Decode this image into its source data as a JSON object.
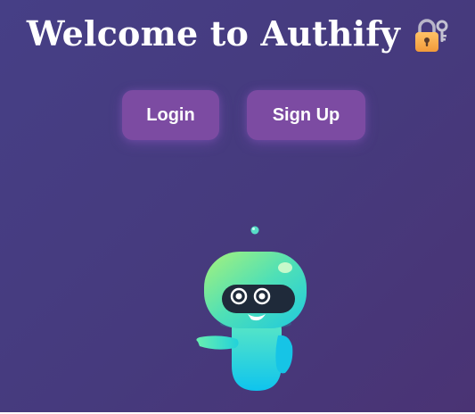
{
  "page": {
    "title": "Welcome to Authify",
    "title_icon": "lock-with-key-icon"
  },
  "actions": {
    "login_label": "Login",
    "signup_label": "Sign Up"
  },
  "illustration": {
    "icon": "robot-mascot-icon"
  },
  "colors": {
    "background_start": "#463f86",
    "background_end": "#4a3374",
    "button": "#7c4ba2",
    "text": "#ffffff",
    "robot_gradient_start": "#7ef29a",
    "robot_gradient_end": "#19c9e6"
  }
}
